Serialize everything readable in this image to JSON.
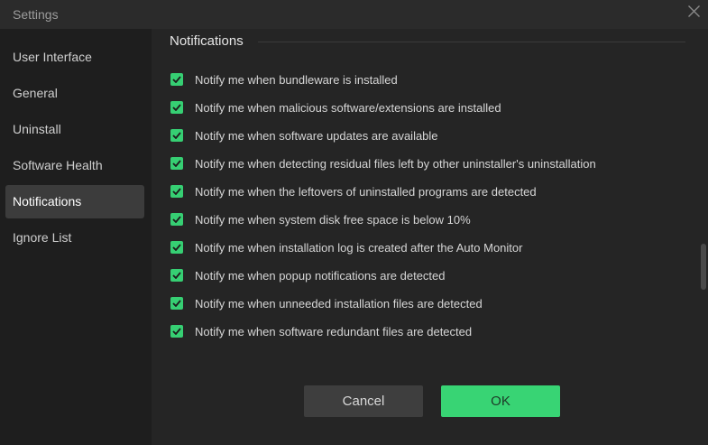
{
  "window": {
    "title": "Settings",
    "close_icon": "close-icon"
  },
  "sidebar": {
    "items": [
      {
        "label": "User Interface",
        "active": false
      },
      {
        "label": "General",
        "active": false
      },
      {
        "label": "Uninstall",
        "active": false
      },
      {
        "label": "Software Health",
        "active": false
      },
      {
        "label": "Notifications",
        "active": true
      },
      {
        "label": "Ignore List",
        "active": false
      }
    ]
  },
  "main": {
    "section_title": "Notifications",
    "options": [
      {
        "label": "Notify me when bundleware is installed",
        "checked": true
      },
      {
        "label": "Notify me when malicious software/extensions are installed",
        "checked": true
      },
      {
        "label": "Notify me when software updates are available",
        "checked": true
      },
      {
        "label": "Notify me when detecting residual files left by other uninstaller's uninstallation",
        "checked": true
      },
      {
        "label": "Notify me when the leftovers of uninstalled programs are detected",
        "checked": true
      },
      {
        "label": "Notify me when system disk free space is below 10%",
        "checked": true
      },
      {
        "label": "Notify me when installation log is created after the Auto Monitor",
        "checked": true
      },
      {
        "label": "Notify me when popup notifications are detected",
        "checked": true
      },
      {
        "label": "Notify me when unneeded installation files are detected",
        "checked": true
      },
      {
        "label": "Notify me when software redundant files are detected",
        "checked": true
      }
    ]
  },
  "footer": {
    "cancel_label": "Cancel",
    "ok_label": "OK"
  },
  "colors": {
    "accent": "#38d474",
    "background": "#252525",
    "sidebar": "#1e1e1e",
    "active_item": "#3c3c3c"
  }
}
